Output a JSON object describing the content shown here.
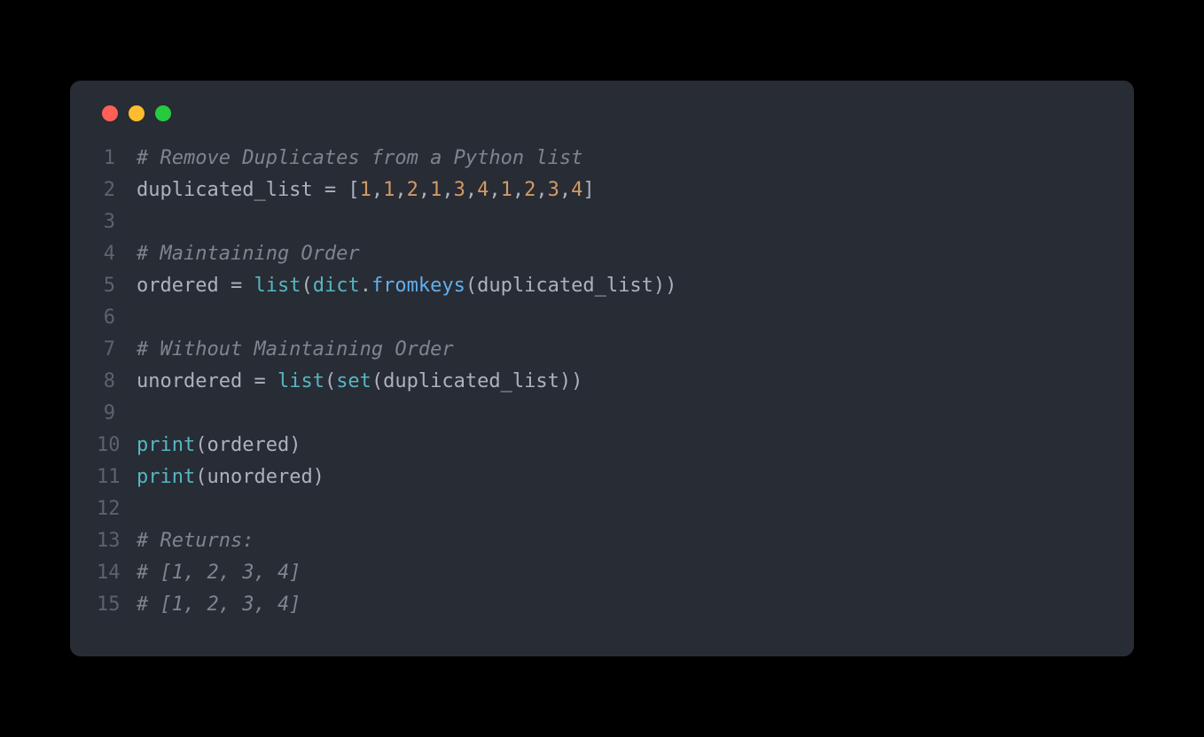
{
  "window": {
    "controls": [
      "close",
      "minimize",
      "maximize"
    ]
  },
  "colors": {
    "close": "#ff5f56",
    "minimize": "#ffbd2e",
    "maximize": "#27c93f",
    "background": "#282c34",
    "comment": "#7f848e",
    "default": "#abb2bf",
    "keyword": "#c678dd",
    "builtin": "#56b6c2",
    "func": "#61afef",
    "number": "#d19a66",
    "lineNumber": "#5c6370"
  },
  "code": {
    "lines": [
      {
        "num": "1",
        "tokens": [
          {
            "t": "# Remove Duplicates from a Python list",
            "c": "comment"
          }
        ]
      },
      {
        "num": "2",
        "tokens": [
          {
            "t": "duplicated_list ",
            "c": "default"
          },
          {
            "t": "=",
            "c": "operator"
          },
          {
            "t": " [",
            "c": "punct"
          },
          {
            "t": "1",
            "c": "number"
          },
          {
            "t": ",",
            "c": "punct"
          },
          {
            "t": "1",
            "c": "number"
          },
          {
            "t": ",",
            "c": "punct"
          },
          {
            "t": "2",
            "c": "number"
          },
          {
            "t": ",",
            "c": "punct"
          },
          {
            "t": "1",
            "c": "number"
          },
          {
            "t": ",",
            "c": "punct"
          },
          {
            "t": "3",
            "c": "number"
          },
          {
            "t": ",",
            "c": "punct"
          },
          {
            "t": "4",
            "c": "number"
          },
          {
            "t": ",",
            "c": "punct"
          },
          {
            "t": "1",
            "c": "number"
          },
          {
            "t": ",",
            "c": "punct"
          },
          {
            "t": "2",
            "c": "number"
          },
          {
            "t": ",",
            "c": "punct"
          },
          {
            "t": "3",
            "c": "number"
          },
          {
            "t": ",",
            "c": "punct"
          },
          {
            "t": "4",
            "c": "number"
          },
          {
            "t": "]",
            "c": "punct"
          }
        ]
      },
      {
        "num": "3",
        "tokens": []
      },
      {
        "num": "4",
        "tokens": [
          {
            "t": "# Maintaining Order",
            "c": "comment"
          }
        ]
      },
      {
        "num": "5",
        "tokens": [
          {
            "t": "ordered ",
            "c": "default"
          },
          {
            "t": "=",
            "c": "operator"
          },
          {
            "t": " ",
            "c": "default"
          },
          {
            "t": "list",
            "c": "builtin"
          },
          {
            "t": "(",
            "c": "punct"
          },
          {
            "t": "dict",
            "c": "builtin"
          },
          {
            "t": ".",
            "c": "punct"
          },
          {
            "t": "fromkeys",
            "c": "func"
          },
          {
            "t": "(duplicated_list))",
            "c": "punct"
          }
        ]
      },
      {
        "num": "6",
        "tokens": []
      },
      {
        "num": "7",
        "tokens": [
          {
            "t": "# Without Maintaining Order",
            "c": "comment"
          }
        ]
      },
      {
        "num": "8",
        "tokens": [
          {
            "t": "unordered ",
            "c": "default"
          },
          {
            "t": "=",
            "c": "operator"
          },
          {
            "t": " ",
            "c": "default"
          },
          {
            "t": "list",
            "c": "builtin"
          },
          {
            "t": "(",
            "c": "punct"
          },
          {
            "t": "set",
            "c": "builtin"
          },
          {
            "t": "(duplicated_list))",
            "c": "punct"
          }
        ]
      },
      {
        "num": "9",
        "tokens": []
      },
      {
        "num": "10",
        "tokens": [
          {
            "t": "print",
            "c": "builtin"
          },
          {
            "t": "(ordered)",
            "c": "punct"
          }
        ]
      },
      {
        "num": "11",
        "tokens": [
          {
            "t": "print",
            "c": "builtin"
          },
          {
            "t": "(unordered)",
            "c": "punct"
          }
        ]
      },
      {
        "num": "12",
        "tokens": []
      },
      {
        "num": "13",
        "tokens": [
          {
            "t": "# Returns:",
            "c": "comment"
          }
        ]
      },
      {
        "num": "14",
        "tokens": [
          {
            "t": "# [1, 2, 3, 4]",
            "c": "comment"
          }
        ]
      },
      {
        "num": "15",
        "tokens": [
          {
            "t": "# [1, 2, 3, 4]",
            "c": "comment"
          }
        ]
      }
    ]
  }
}
